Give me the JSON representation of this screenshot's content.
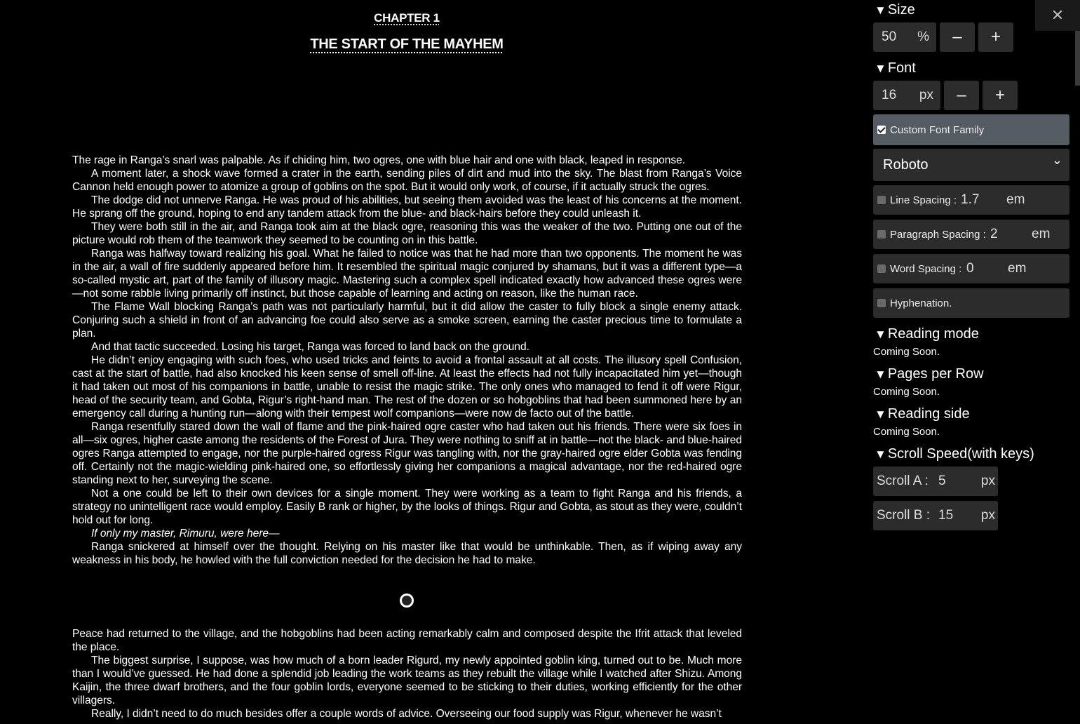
{
  "chapter": {
    "label": "CHAPTER 1",
    "title": "THE START OF THE MAYHEM"
  },
  "block1": [
    "The rage in Ranga’s snarl was palpable. As if chiding him, two ogres, one with blue hair and one with black, leaped in response.",
    "A moment later, a shock wave formed a crater in the earth, sending piles of dirt and mud into the sky. The blast from Ranga’s Voice Cannon held enough power to atomize a group of goblins on the spot. But it would only work, of course, if it actually struck the ogres.",
    "The dodge did not unnerve Ranga. He was proud of his abilities, but seeing them avoided was the least of his concerns at the moment. He sprang off the ground, hoping to end any tandem attack from the blue- and black-hairs before they could unleash it.",
    "They were both still in the air, and Ranga took aim at the black ogre, reasoning this was the weaker of the two. Putting one out of the picture would rob them of the teamwork they seemed to be counting on in this battle.",
    "Ranga was halfway toward realizing his goal. What he failed to notice was that he had more than two opponents. The moment he was in the air, a wall of fire suddenly appeared before him. It resembled the spiritual magic conjured by shamans, but it was a different type—a so-called mystic art, part of the family of illusory magic. Mastering such a complex spell indicated exactly how advanced these ogres were—not some rabble living primarily off instinct, but those capable of learning and acting on reason, like the human race.",
    "The Flame Wall blocking Ranga’s path was not particularly harmful, but it did allow the caster to fully block a single enemy attack. Conjuring such a shield in front of an advancing foe could also serve as a smoke screen, earning the caster precious time to formulate a plan.",
    "And that tactic succeeded. Losing his target, Ranga was forced to land back on the ground.",
    "He didn’t enjoy engaging with such foes, who used tricks and feints to avoid a frontal assault at all costs. The illusory spell Confusion, cast at the start of battle, had also knocked his keen sense of smell off-line. At least the effects had not fully incapacitated him yet—though it had taken out most of his companions in battle, unable to resist the magic strike. The only ones who managed to fend it off were Rigur, head of the security team, and Gobta, Rigur’s right-hand man. The rest of the dozen or so hobgoblins that had been summoned here by an emergency call during a hunting run—along with their tempest wolf companions—were now de facto out of the battle.",
    "Ranga resentfully stared down the wall of flame and the pink-haired ogre caster who had taken out his friends. There were six foes in all—six ogres, higher caste among the residents of the Forest of Jura. They were nothing to sniff at in battle—not the black- and blue-haired ogres Ranga attempted to engage, nor the purple-haired ogress Rigur was tangling with, nor the gray-haired ogre elder Gobta was fending off. Certainly not the magic-wielding pink-haired one, so effortlessly giving her companions a magical advantage, nor the red-haired ogre standing next to her, surveying the scene.",
    "Not a one could be left to their own devices for a single moment. They were working as a team to fight Ranga and his friends, a strategy no unintelligent race would employ. Easily B rank or higher, by the looks of things. Rigur and Gobta, as stout as they were, couldn’t hold out for long.",
    "If only my master, Rimuru, were here—",
    "Ranga snickered at himself over the thought. Relying on his master like that would be unthinkable. Then, as if wiping away any weakness in his body, he howled with the full conviction needed for the decision he had to make."
  ],
  "block2": [
    "Peace had returned to the village, and the hobgoblins had been acting remarkably calm and composed despite the Ifrit attack that leveled the place.",
    "The biggest surprise, I suppose, was how much of a born leader Rigurd, my newly appointed goblin king, turned out to be. Much more than I would’ve guessed. He had done a splendid job leading the work teams as they rebuilt the village while I watched after Shizu. Among Kaijin, the three dwarf brothers, and the four goblin lords, everyone seemed to be sticking to their duties, working efficiently for the other villagers.",
    "Really, I didn’t need to do much besides offer a couple words of advice. Overseeing our food supply was Rigur, whenever he wasn’t"
  ],
  "panel": {
    "close": "✕",
    "size": {
      "title": "Size",
      "value": "50",
      "unit": "%",
      "minus": "–",
      "plus": "+"
    },
    "font": {
      "title": "Font",
      "value": "16",
      "unit": "px",
      "minus": "–",
      "plus": "+"
    },
    "custom_font": {
      "label": "Custom Font Family",
      "checked": true
    },
    "font_select": {
      "value": "Roboto",
      "chevron": "⌄"
    },
    "line_spacing": {
      "label": "Line Spacing :",
      "value": "1.7",
      "unit": "em",
      "checked": false
    },
    "paragraph_spacing": {
      "label": "Paragraph Spacing :",
      "value": "2",
      "unit": "em",
      "checked": false
    },
    "word_spacing": {
      "label": "Word Spacing :",
      "value": "0",
      "unit": "em",
      "checked": false
    },
    "hyphenation": {
      "label": "Hyphenation.",
      "checked": false
    },
    "reading_mode": {
      "title": "Reading mode",
      "note": "Coming Soon."
    },
    "pages_per_row": {
      "title": "Pages per Row",
      "note": "Coming Soon."
    },
    "reading_side": {
      "title": "Reading side",
      "note": "Coming Soon."
    },
    "scroll_speed": {
      "title": "Scroll Speed(with keys)",
      "a": {
        "label": "Scroll A :",
        "value": "5",
        "unit": "px"
      },
      "b": {
        "label": "Scroll B :",
        "value": "15",
        "unit": "px"
      }
    },
    "triangle": "▼"
  }
}
